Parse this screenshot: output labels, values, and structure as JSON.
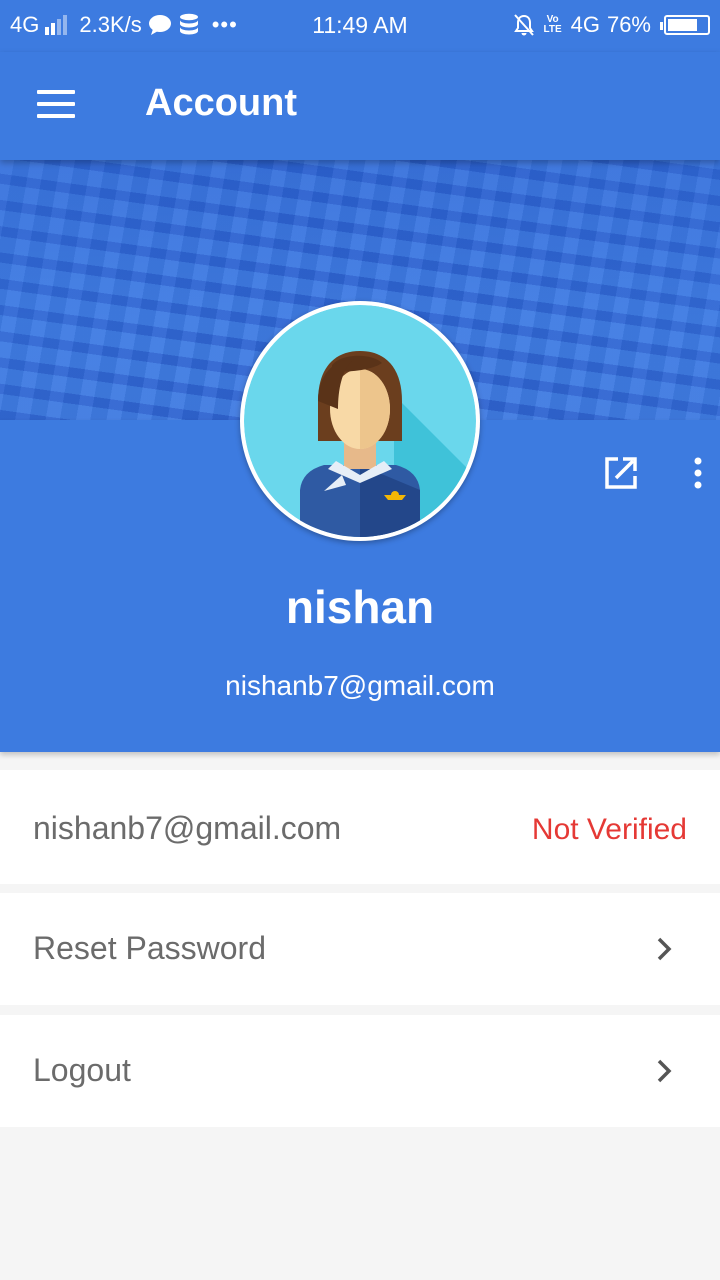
{
  "status_bar": {
    "network_left": "4G",
    "speed": "2.3K/s",
    "time": "11:49 AM",
    "network_right": "4G",
    "volte": "Vo LTE",
    "battery_percent": "76%",
    "battery_level": 0.76,
    "more_dots": "•••"
  },
  "appbar": {
    "title": "Account",
    "menu_icon": "hamburger-menu-icon"
  },
  "profile": {
    "name": "nishan",
    "email": "nishanb7@gmail.com",
    "avatar_icon": "female-avatar-icon",
    "edit_icon": "open-in-new-icon",
    "more_icon": "more-vert-icon"
  },
  "list": {
    "email_row": {
      "label": "nishanb7@gmail.com",
      "status": "Not Verified"
    },
    "reset_row": {
      "label": "Reset Password"
    },
    "logout_row": {
      "label": "Logout"
    }
  },
  "colors": {
    "primary": "#3d7be0",
    "status_error": "#e53935",
    "text_gray": "#6b6b6b"
  }
}
